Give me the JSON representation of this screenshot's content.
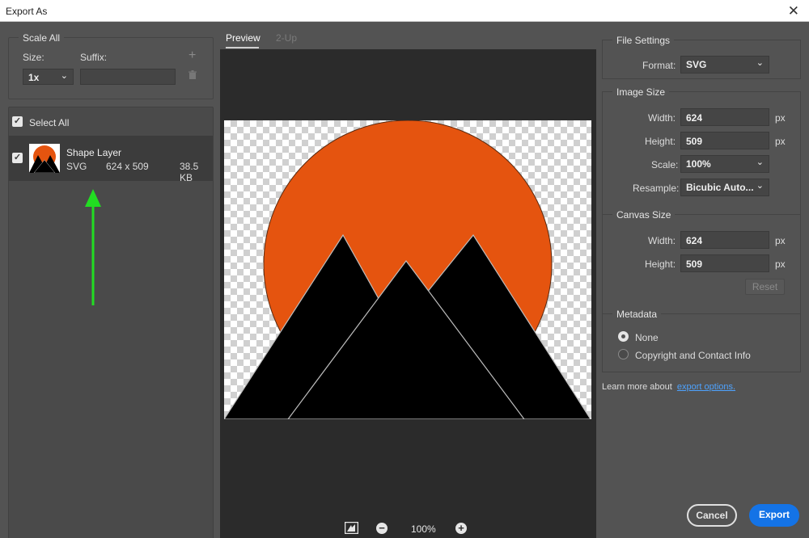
{
  "window": {
    "title": "Export As",
    "close_glyph": "✕"
  },
  "scale_all": {
    "legend": "Scale All",
    "size_label": "Size:",
    "suffix_label": "Suffix:",
    "size_value": "1x",
    "suffix_value": "",
    "add_icon": "+",
    "delete_icon": "🗑"
  },
  "layers": {
    "select_all_label": "Select All",
    "items": [
      {
        "name": "Shape Layer",
        "format": "SVG",
        "dimensions": "624 x 509",
        "size": "38.5 KB"
      }
    ]
  },
  "preview": {
    "tabs": [
      "Preview",
      "2-Up"
    ],
    "zoom": "100%",
    "colors": {
      "sun": "#E5540F",
      "mountain": "#000000",
      "outline": "#BDBDBD",
      "arrow": "#22DD22"
    }
  },
  "file_settings": {
    "legend": "File Settings",
    "format_label": "Format:",
    "format_value": "SVG"
  },
  "image_size": {
    "legend": "Image Size",
    "width_label": "Width:",
    "width_value": "624",
    "height_label": "Height:",
    "height_value": "509",
    "scale_label": "Scale:",
    "scale_value": "100%",
    "resample_label": "Resample:",
    "resample_value": "Bicubic Auto...",
    "unit": "px"
  },
  "canvas_size": {
    "legend": "Canvas Size",
    "width_label": "Width:",
    "width_value": "624",
    "height_label": "Height:",
    "height_value": "509",
    "unit": "px",
    "reset_label": "Reset"
  },
  "metadata": {
    "legend": "Metadata",
    "options": [
      "None",
      "Copyright and Contact Info"
    ],
    "selected": "None"
  },
  "learn_more": {
    "text": "Learn more about",
    "link": "export options."
  },
  "buttons": {
    "cancel": "Cancel",
    "export": "Export"
  }
}
